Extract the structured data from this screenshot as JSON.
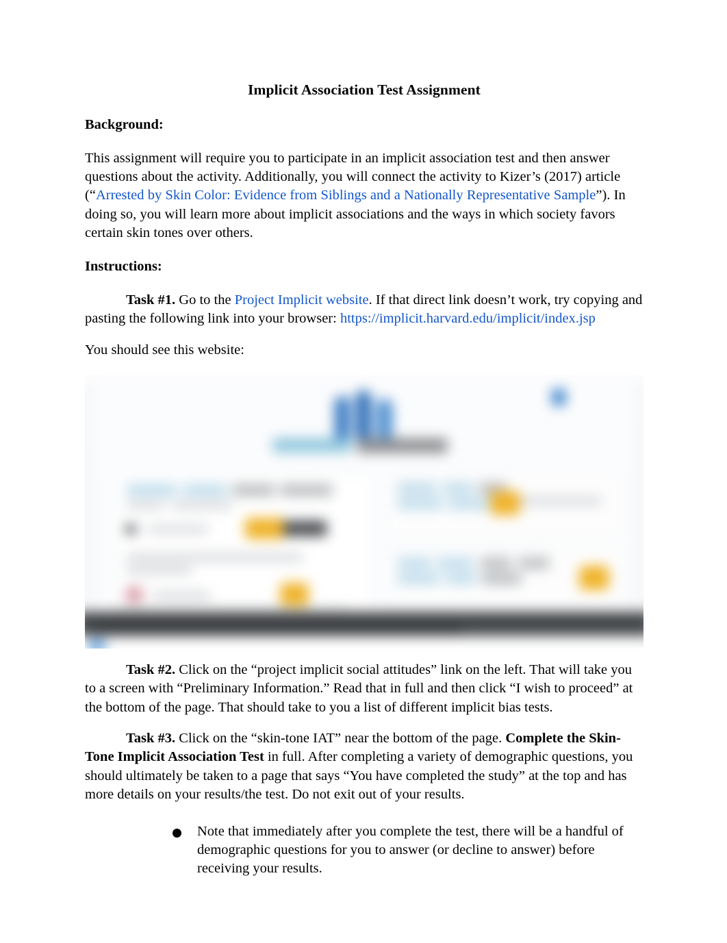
{
  "document": {
    "title": "Implicit Association Test Assignment",
    "sections": {
      "background_heading": "Background:",
      "background_para_part1": "This assignment will require you to participate in an implicit association test and then answer questions about the activity. Additionally, you will connect the activity to Kizer’s (2017) article (“",
      "background_link": "Arrested by Skin Color: Evidence from Siblings and a Nationally Representative Sample",
      "background_para_part2": "”). In doing so, you will learn more about implicit associations and the ways in which society favors certain skin tones over others.",
      "instructions_heading": "Instructions:"
    },
    "tasks": {
      "task1_label": "Task #1.",
      "task1_text_part1": " Go to the ",
      "task1_link_text": "Project Implicit website",
      "task1_text_part2": ". If that direct link doesn’t work, try copying and pasting the following link into your browser: ",
      "task1_url": "https://implicit.harvard.edu/implicit/index.jsp",
      "task1_caption": "You should see this website:",
      "task2_label": "Task #2.",
      "task2_text": " Click on the “project implicit social attitudes” link on the left. That will take you to a screen with “Preliminary Information.” Read that in full and then click “I wish to proceed” at the bottom of the page. That should take to you a list of different implicit bias tests.",
      "task3_label": "Task #3.",
      "task3_text_part1": " Click on the “skin-tone IAT” near the bottom of the page. ",
      "task3_bold_phrase": "Complete the Skin-Tone Implicit Association Test",
      "task3_text_part2": " in full. After completing a variety of demographic questions, you should ultimately be taken to a page that says “You have completed the study” at the top and has more details on your results/the test. Do not exit out of your results."
    },
    "bullets": [
      "Note that immediately after you complete the test, there will be a handful of demographic questions for you to answer (or decline to answer) before receiving your results."
    ],
    "embedded_screenshot": {
      "description": "Blurred screenshot of the Project Implicit website homepage",
      "logo_name": "project-implicit-logo",
      "colors": {
        "logo_blue": "#2f6fb8",
        "logo_teal": "#8fc6dd",
        "button_yellow": "#f0b42c",
        "footer_dark": "#434649",
        "accent_blue": "#4b93d8"
      }
    }
  },
  "colors": {
    "link_blue": "#1256CC",
    "text_black": "#000000",
    "page_background": "#ffffff"
  }
}
